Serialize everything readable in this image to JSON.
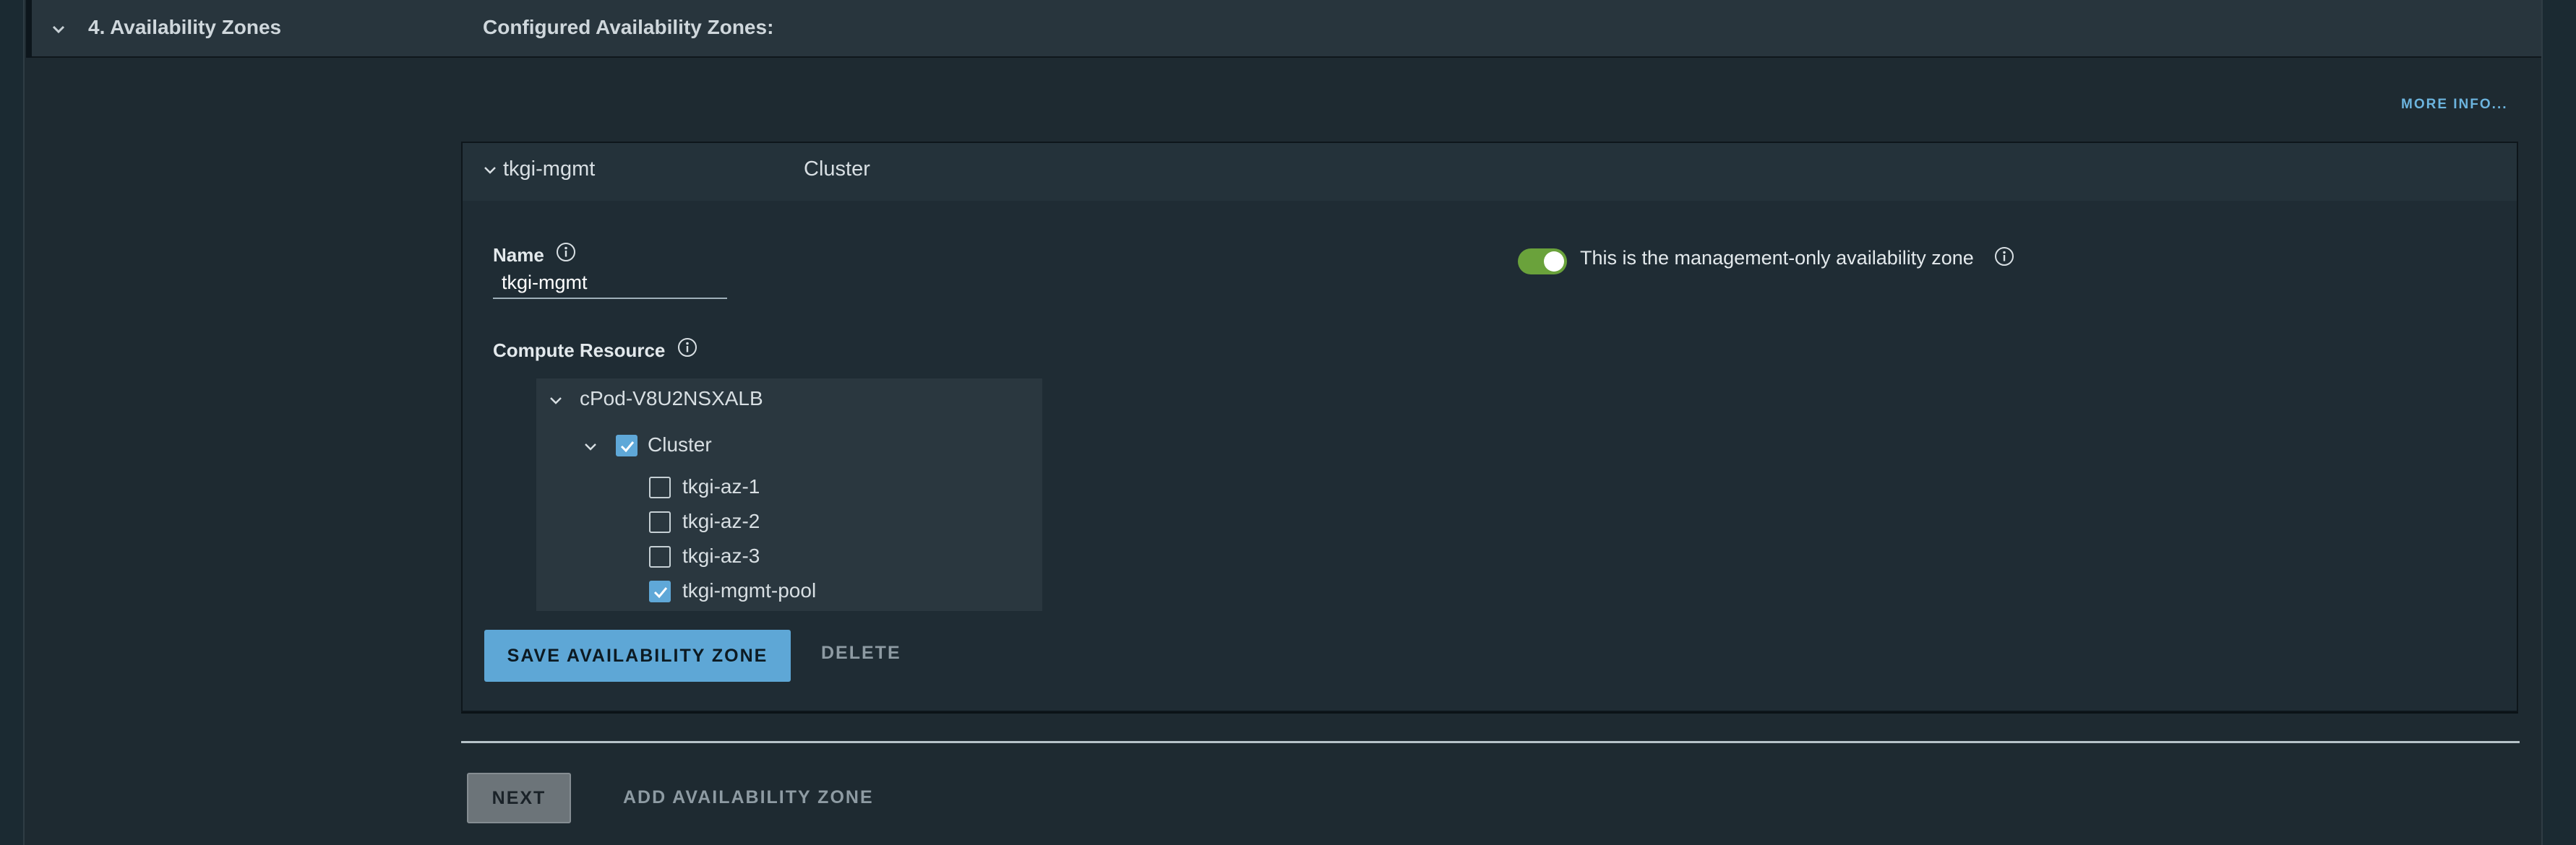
{
  "step": {
    "title": "4. Availability Zones",
    "subtitle": "Configured Availability Zones:"
  },
  "more_info_label": "MORE INFO...",
  "az": {
    "name": "tkgi-mgmt",
    "header_cluster": "Cluster",
    "name_label": "Name",
    "name_value": "tkgi-mgmt",
    "management_toggle": {
      "label": "This is the management-only availability zone",
      "on": true
    },
    "compute_label": "Compute Resource",
    "tree": {
      "root": "cPod-V8U2NSXALB",
      "cluster": {
        "label": "Cluster",
        "checked": true
      },
      "pools": [
        {
          "label": "tkgi-az-1",
          "checked": false
        },
        {
          "label": "tkgi-az-2",
          "checked": false
        },
        {
          "label": "tkgi-az-3",
          "checked": false
        },
        {
          "label": "tkgi-mgmt-pool",
          "checked": true
        }
      ]
    },
    "save_label": "SAVE AVAILABILITY ZONE",
    "delete_label": "DELETE"
  },
  "footer": {
    "next_label": "NEXT",
    "add_label": "ADD AVAILABILITY ZONE"
  },
  "colors": {
    "accent": "#5ea7d6",
    "toggle_on": "#6aa23b",
    "background": "#1b2a32"
  }
}
